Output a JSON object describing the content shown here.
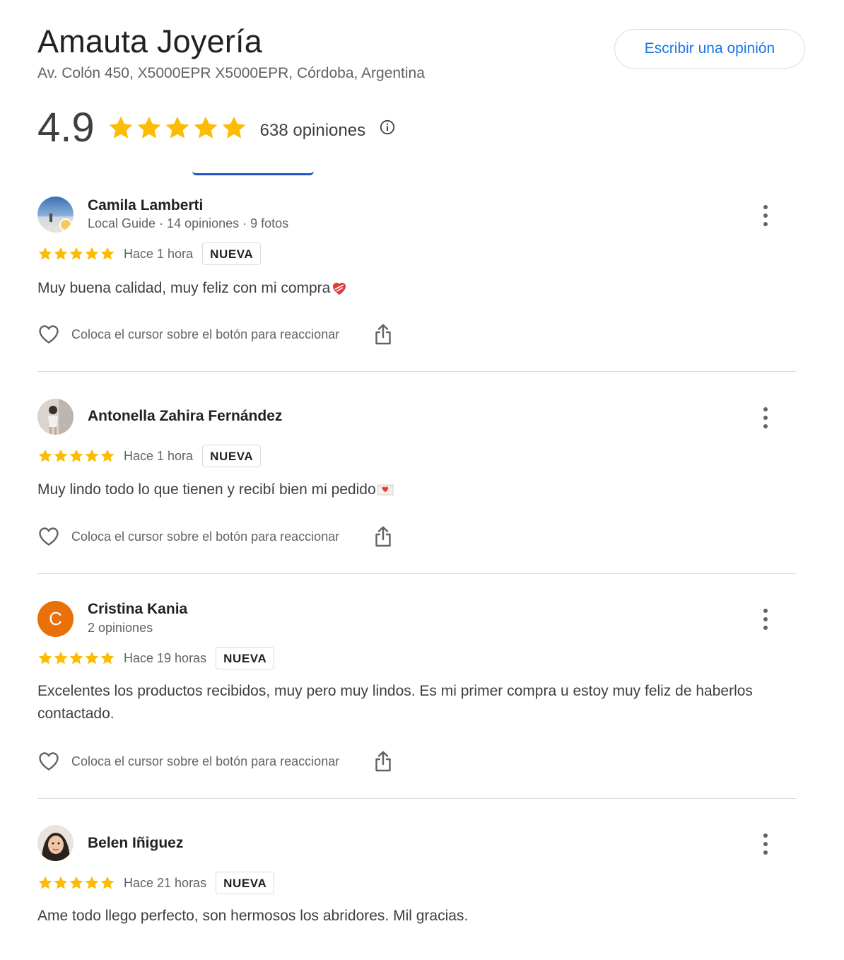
{
  "business": {
    "name": "Amauta Joyería",
    "address": "Av. Colón 450, X5000EPR X5000EPR, Córdoba, Argentina",
    "write_review_label": "Escribir una opinión",
    "rating": "4.9",
    "stars": 5,
    "review_count": "638 opiniones"
  },
  "colors": {
    "star": "#fbbc04",
    "link": "#1a73e8",
    "tab_indicator": "#1a56c7",
    "avatar_orange": "#e8710a"
  },
  "reviews": [
    {
      "name": "Camila Lamberti",
      "meta": "Local Guide · 14 opiniones · 9 fotos",
      "stars": 5,
      "time": "Hace 1 hora",
      "badge": "NUEVA",
      "text": "Muy buena calidad, muy feliz con mi compra",
      "emoji": "mending-heart",
      "react_label": "Coloca el cursor sobre el botón para reaccionar",
      "avatar_icon": "beach-photo-avatar"
    },
    {
      "name": "Antonella Zahira Fernández",
      "meta": "",
      "stars": 5,
      "time": "Hace 1 hora",
      "badge": "NUEVA",
      "text": "Muy lindo todo lo que tienen y recibí bien mi pedido",
      "emoji": "love-letter",
      "react_label": "Coloca el cursor sobre el botón para reaccionar",
      "avatar_icon": "mirror-selfie-avatar"
    },
    {
      "name": "Cristina Kania",
      "meta": "2 opiniones",
      "stars": 5,
      "time": "Hace 19 horas",
      "badge": "NUEVA",
      "text": "Excelentes los productos recibidos, muy pero muy lindos. Es mi primer compra u estoy muy feliz de haberlos contactado.",
      "react_label": "Coloca el cursor sobre el botón para reaccionar",
      "avatar_letter": "C"
    },
    {
      "name": "Belen Iñiguez",
      "meta": "",
      "stars": 5,
      "time": "Hace 21 horas",
      "badge": "NUEVA",
      "text": "Ame todo llego perfecto, son hermosos los abridores. Mil gracias.",
      "avatar_icon": "portrait-avatar"
    }
  ]
}
